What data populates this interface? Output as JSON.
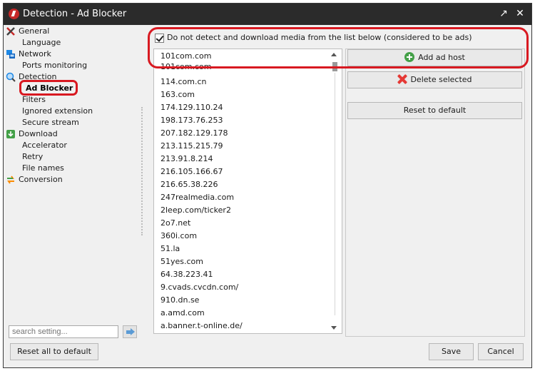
{
  "window": {
    "title": "Detection - Ad Blocker",
    "restore_glyph": "↗",
    "close_glyph": "✕"
  },
  "nav": {
    "items": [
      {
        "label": "General",
        "level": 0,
        "icon": "tools-icon"
      },
      {
        "label": "Language",
        "level": 1
      },
      {
        "label": "Network",
        "level": 0,
        "icon": "network-icon"
      },
      {
        "label": "Ports monitoring",
        "level": 1
      },
      {
        "label": "Detection",
        "level": 0,
        "icon": "magnifier-icon"
      },
      {
        "label": "Ad Blocker",
        "level": 1,
        "selected": true
      },
      {
        "label": "Filters",
        "level": 1
      },
      {
        "label": "Ignored extension",
        "level": 1
      },
      {
        "label": "Secure stream",
        "level": 1
      },
      {
        "label": "Download",
        "level": 0,
        "icon": "download-icon"
      },
      {
        "label": "Accelerator",
        "level": 1
      },
      {
        "label": "Retry",
        "level": 1
      },
      {
        "label": "File names",
        "level": 1
      },
      {
        "label": "Conversion",
        "level": 0,
        "icon": "conversion-icon"
      }
    ]
  },
  "search": {
    "placeholder": "search setting..."
  },
  "adblock": {
    "checkbox_label": "Do not detect and download media from the list below (considered to be ads)",
    "checked": true,
    "hosts": [
      "101com.com",
      "101com.com",
      "114.com.cn",
      "163.com",
      "174.129.110.24",
      "198.173.76.253",
      "207.182.129.178",
      "213.115.215.79",
      "213.91.8.214",
      "216.105.166.67",
      "216.65.38.226",
      "247realmedia.com",
      "2leep.com/ticker2",
      "2o7.net",
      "360i.com",
      "51.la",
      "51yes.com",
      "64.38.223.41",
      "9.cvads.cvcdn.com/",
      "910.dn.se",
      "a.amd.com",
      "a.banner.t-online.de/"
    ],
    "add_label": "Add ad host",
    "delete_label": "Delete selected",
    "reset_label": "Reset to default"
  },
  "footer": {
    "reset_all_label": "Reset all to default",
    "save_label": "Save",
    "cancel_label": "Cancel"
  },
  "colors": {
    "titlebar": "#2b2b2b",
    "highlight": "#d81921",
    "panel": "#f0f0f0"
  }
}
